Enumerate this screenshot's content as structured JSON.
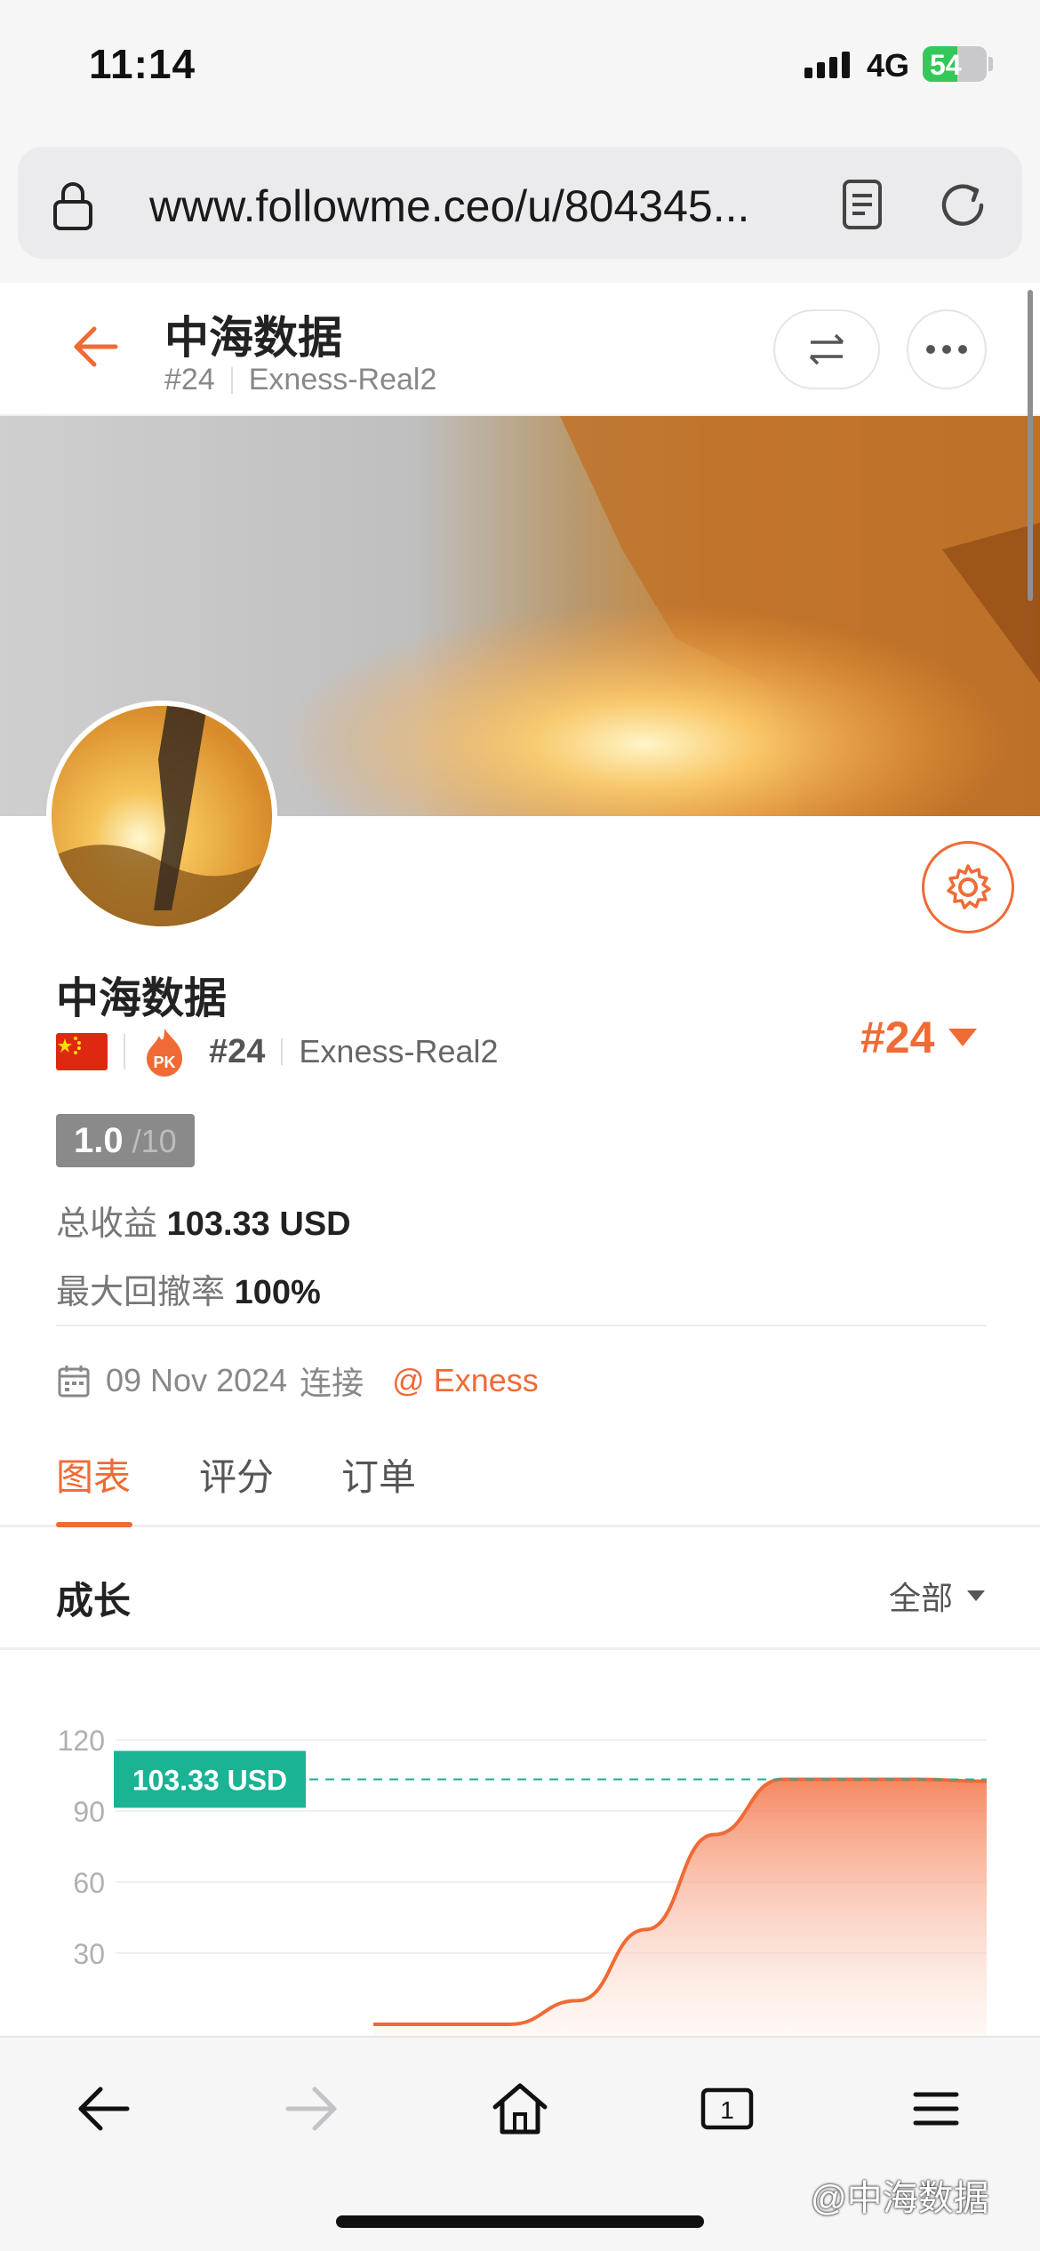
{
  "status_bar": {
    "time": "11:14",
    "network": "4G",
    "battery": "54",
    "battery_level": 0.54
  },
  "browser": {
    "url": "www.followme.ceo/u/804345..."
  },
  "header": {
    "title": "中海数据",
    "rank": "#24",
    "broker": "Exness-Real2"
  },
  "profile": {
    "name": "中海数据",
    "rank": "#24",
    "broker": "Exness-Real2",
    "rank_right": "#24",
    "score": "1.0",
    "score_max": "/10",
    "total_profit_label": "总收益",
    "total_profit_value": "103.33",
    "total_profit_unit": "USD",
    "drawdown_label": "最大回撤率",
    "drawdown_value": "100%",
    "connected_date": "09 Nov 2024",
    "connected_label": "连接",
    "broker_link": "@ Exness"
  },
  "tabs": [
    {
      "label": "图表",
      "active": true
    },
    {
      "label": "评分",
      "active": false
    },
    {
      "label": "订单",
      "active": false
    }
  ],
  "growth": {
    "title": "成长",
    "filter": "全部"
  },
  "chart_data": {
    "type": "area",
    "y_ticks": [
      "120",
      "90",
      "60",
      "30"
    ],
    "ylim": [
      0,
      120
    ],
    "current_label": "103.33 USD",
    "series": [
      {
        "values": [
          0,
          0,
          0,
          10,
          40,
          80,
          103.33,
          103.33,
          103.33,
          102.5
        ]
      }
    ],
    "colors": {
      "line": "#f06a35",
      "marker": "#1ab394"
    }
  },
  "watermark": "@中海数据",
  "colors": {
    "accent": "#f06a35",
    "teal": "#1ab394"
  }
}
